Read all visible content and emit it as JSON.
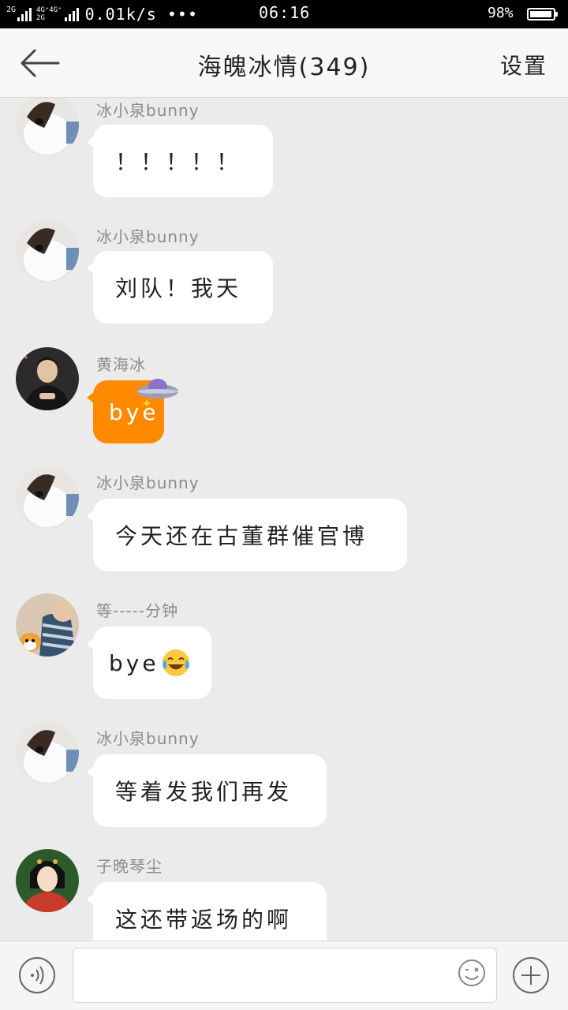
{
  "status_bar": {
    "net_a": "2G",
    "net_b_top": "4G⁺4G⁺",
    "net_b_bottom": "2G",
    "speed": "0.01k/s •••",
    "time": "06:16",
    "battery_pct": "98%",
    "battery_level": 0.98
  },
  "header": {
    "back_icon": "back-arrow-icon",
    "title": "海魄冰情(349)",
    "settings_label": "设置"
  },
  "messages": [
    {
      "sender": "冰小泉bunny",
      "text": "！！！！！",
      "avatar": "rabbit-avatar"
    },
    {
      "sender": "冰小泉bunny",
      "text": "刘队！我天",
      "avatar": "rabbit-avatar"
    },
    {
      "sender": "黄海冰",
      "text": "bye",
      "avatar": "man-avatar",
      "bubble_color": "#ff8a00",
      "decoration": "ufo-sparkle-icon"
    },
    {
      "sender": "冰小泉bunny",
      "text": "今天还在古董群催官博",
      "avatar": "rabbit-avatar"
    },
    {
      "sender": "等-----分钟",
      "text": "bye",
      "avatar": "dog-cartoon-avatar",
      "emoji": "tears-of-joy-emoji"
    },
    {
      "sender": "冰小泉bunny",
      "text": "等着发我们再发",
      "avatar": "rabbit-avatar"
    },
    {
      "sender": "子晚琴尘",
      "text": "这还带返场的啊",
      "avatar": "ancient-lady-avatar"
    }
  ],
  "input_bar": {
    "voice_icon": "voice-icon",
    "input_value": "",
    "emoji_icon": "smiley-icon",
    "plus_icon": "plus-icon"
  }
}
